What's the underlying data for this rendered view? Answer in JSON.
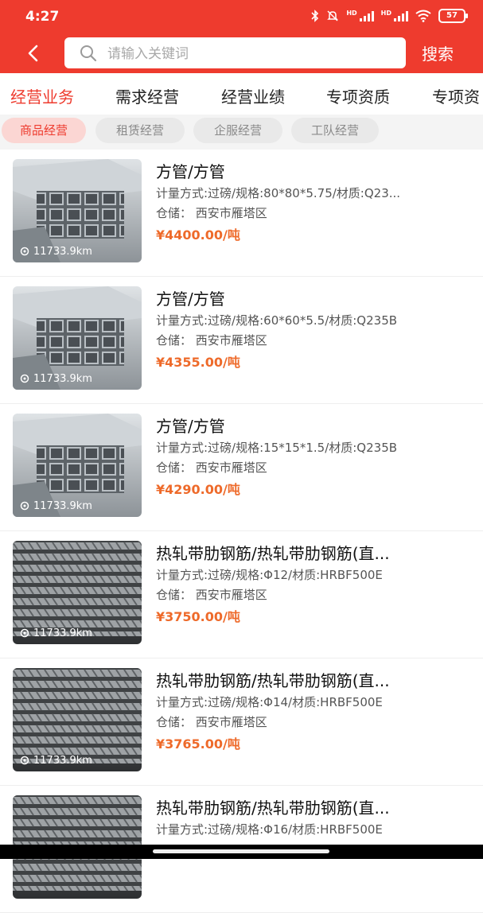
{
  "status": {
    "time": "4:27",
    "battery": "57"
  },
  "search": {
    "placeholder": "请输入关键词",
    "button_label": "搜索"
  },
  "tabs": [
    {
      "label": "经营业务",
      "active": true
    },
    {
      "label": "需求经营"
    },
    {
      "label": "经营业绩"
    },
    {
      "label": "专项资质"
    },
    {
      "label": "专项资"
    }
  ],
  "chips": [
    {
      "label": "商品经营",
      "active": true
    },
    {
      "label": "租赁经营"
    },
    {
      "label": "企服经营"
    },
    {
      "label": "工队经营"
    }
  ],
  "items": [
    {
      "title": "方管/方管",
      "spec": "计量方式:过磅/规格:80*80*5.75/材质:Q23...",
      "store": "仓储： 西安市雁塔区",
      "price": "¥4400.00/吨",
      "distance": "11733.9km",
      "image": "square-tube-photo"
    },
    {
      "title": "方管/方管",
      "spec": "计量方式:过磅/规格:60*60*5.5/材质:Q235B",
      "store": "仓储： 西安市雁塔区",
      "price": "¥4355.00/吨",
      "distance": "11733.9km",
      "image": "square-tube-photo"
    },
    {
      "title": "方管/方管",
      "spec": "计量方式:过磅/规格:15*15*1.5/材质:Q235B",
      "store": "仓储： 西安市雁塔区",
      "price": "¥4290.00/吨",
      "distance": "11733.9km",
      "image": "square-tube-photo"
    },
    {
      "title": "热轧带肋钢筋/热轧带肋钢筋(直...",
      "spec": "计量方式:过磅/规格:Φ12/材质:HRBF500E",
      "store": "仓储： 西安市雁塔区",
      "price": "¥3750.00/吨",
      "distance": "11733.9km",
      "image": "rebar-photo"
    },
    {
      "title": "热轧带肋钢筋/热轧带肋钢筋(直...",
      "spec": "计量方式:过磅/规格:Φ14/材质:HRBF500E",
      "store": "仓储： 西安市雁塔区",
      "price": "¥3765.00/吨",
      "distance": "11733.9km",
      "image": "rebar-photo"
    },
    {
      "title": "热轧带肋钢筋/热轧带肋钢筋(直...",
      "spec": "计量方式:过磅/规格:Φ16/材质:HRBF500E",
      "store": "",
      "price": "",
      "distance": "",
      "image": "rebar-photo"
    }
  ],
  "colors": {
    "brand": "#ee3b2e",
    "price": "#ee6a2a",
    "chip_active_bg": "#fbd6d3"
  },
  "icons": {
    "back": "chevron-left-icon",
    "search": "search-icon",
    "location": "location-pin-icon"
  }
}
